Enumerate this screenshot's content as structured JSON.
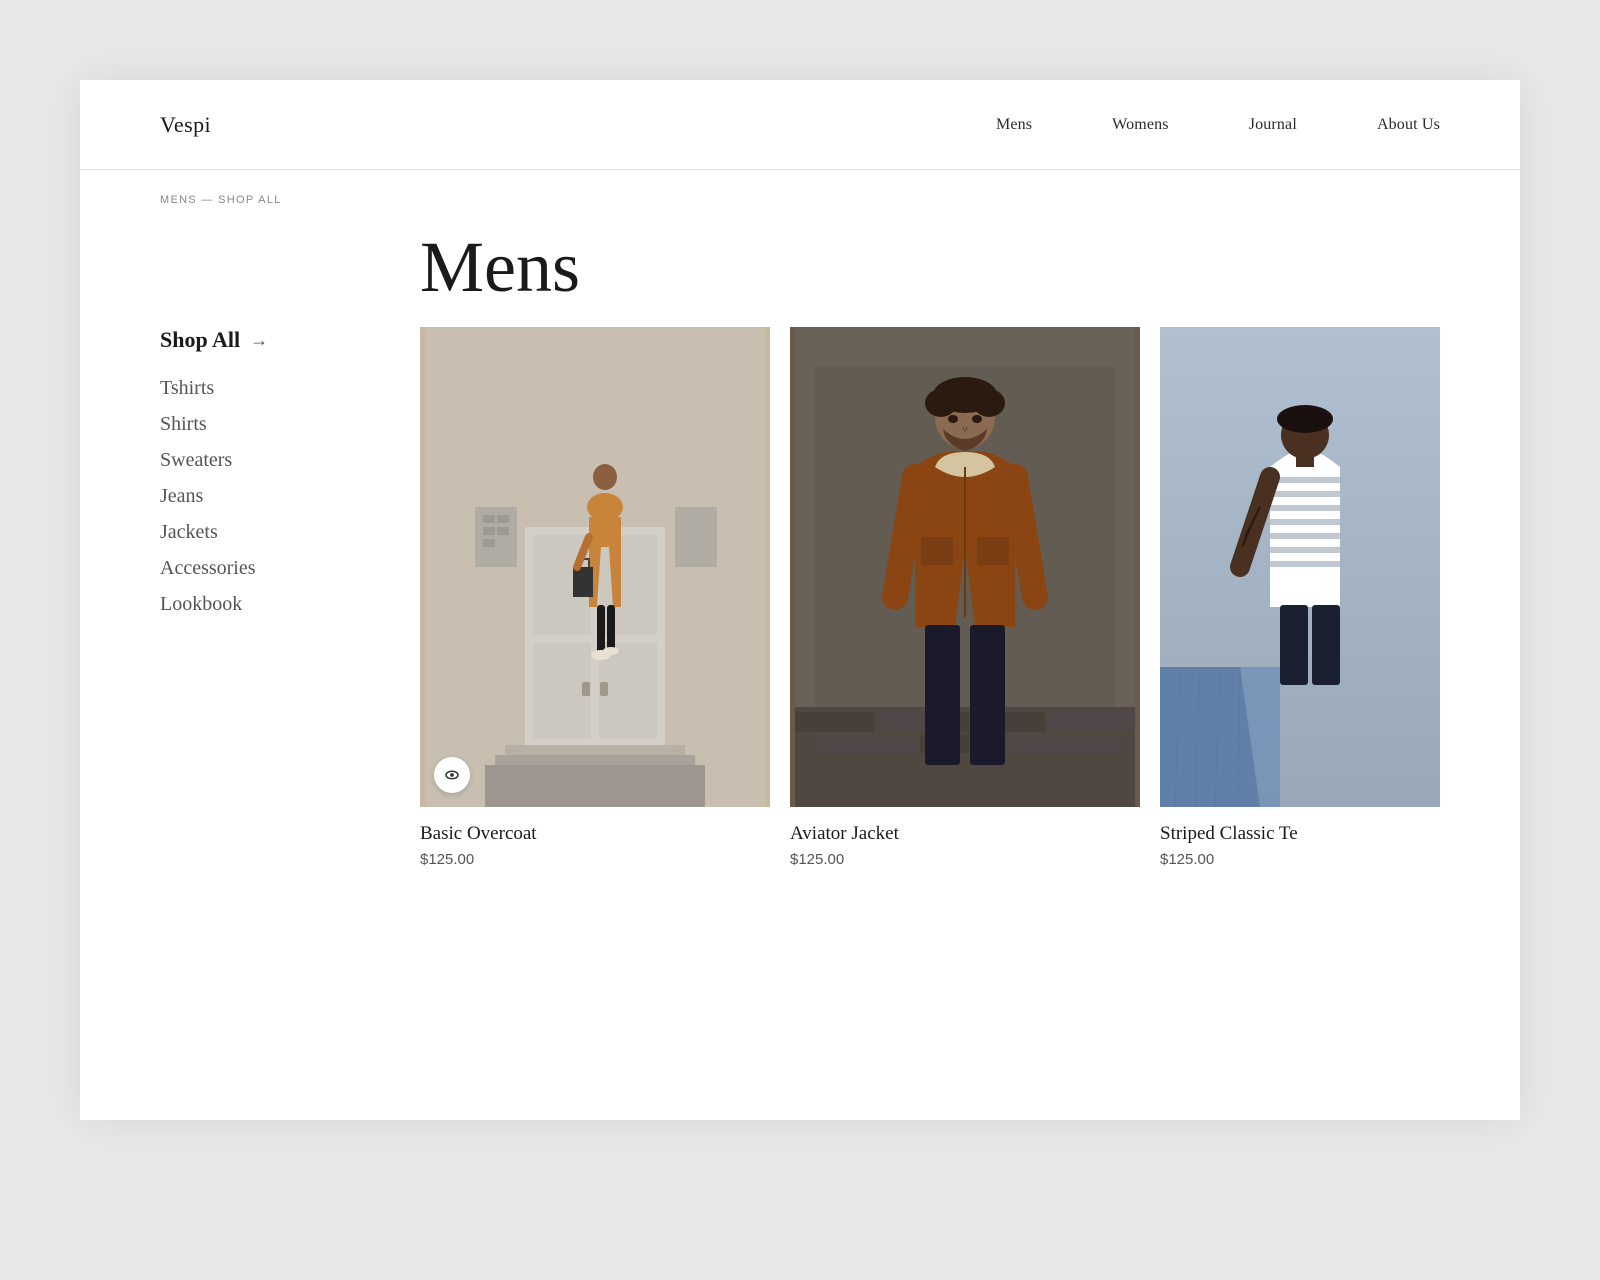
{
  "meta": {
    "background_color": "#e8e8e8",
    "page_bg": "#ffffff"
  },
  "header": {
    "logo": "Vespi",
    "nav": [
      {
        "label": "Mens",
        "id": "mens"
      },
      {
        "label": "Womens",
        "id": "womens"
      },
      {
        "label": "Journal",
        "id": "journal"
      },
      {
        "label": "About Us",
        "id": "about"
      }
    ]
  },
  "breadcrumb": "MENS — SHOP ALL",
  "page_title": "Mens",
  "sidebar": {
    "shop_all": "Shop All",
    "arrow": "→",
    "categories": [
      {
        "label": "Tshirts",
        "id": "tshirts"
      },
      {
        "label": "Shirts",
        "id": "shirts"
      },
      {
        "label": "Sweaters",
        "id": "sweaters"
      },
      {
        "label": "Jeans",
        "id": "jeans"
      },
      {
        "label": "Jackets",
        "id": "jackets"
      },
      {
        "label": "Accessories",
        "id": "accessories"
      },
      {
        "label": "Lookbook",
        "id": "lookbook"
      }
    ]
  },
  "products": [
    {
      "id": "basic-overcoat",
      "name": "Basic Overcoat",
      "price": "$125.00",
      "has_eye_icon": true
    },
    {
      "id": "aviator-jacket",
      "name": "Aviator Jacket",
      "price": "$125.00",
      "has_eye_icon": false
    },
    {
      "id": "striped-classic-tee",
      "name": "Striped Classic Te",
      "price": "$125.00",
      "has_eye_icon": false
    }
  ]
}
